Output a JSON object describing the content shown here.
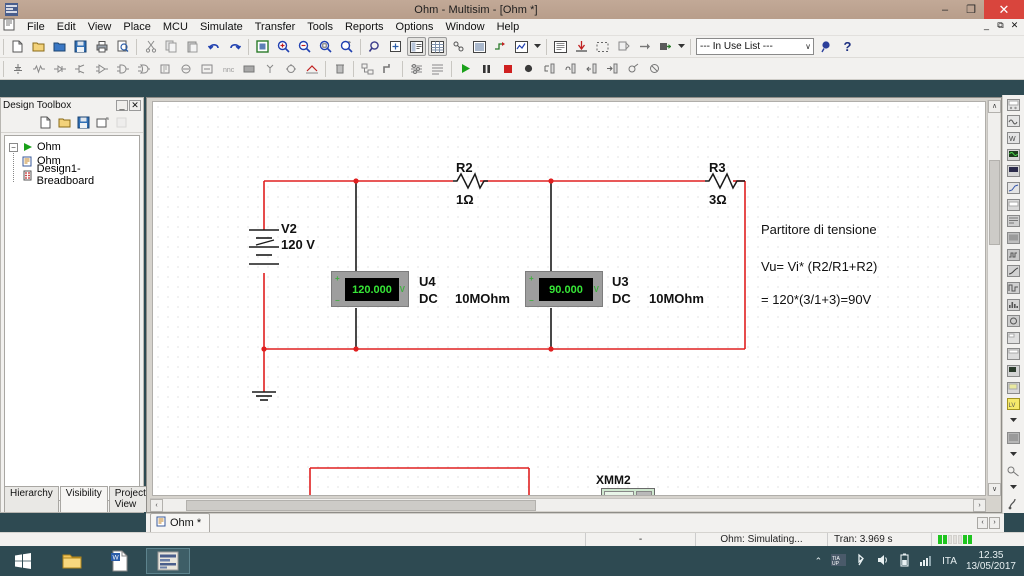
{
  "window": {
    "title": "Ohm - Multisim - [Ohm *]",
    "app_icon": "multisim-icon",
    "minimize_label": "–",
    "maximize_label": "❐",
    "close_label": "✕",
    "mdi_minimize": "_",
    "mdi_restore": "⧉",
    "mdi_close": "✕"
  },
  "menubar": {
    "items": [
      {
        "label": "File"
      },
      {
        "label": "Edit"
      },
      {
        "label": "View"
      },
      {
        "label": "Place"
      },
      {
        "label": "MCU"
      },
      {
        "label": "Simulate"
      },
      {
        "label": "Transfer"
      },
      {
        "label": "Tools"
      },
      {
        "label": "Reports"
      },
      {
        "label": "Options"
      },
      {
        "label": "Window"
      },
      {
        "label": "Help"
      }
    ]
  },
  "toolbar_main": {
    "groups": [
      [
        "new-file-icon",
        "open-file-icon",
        "open-sample-icon",
        "save-icon",
        "print-icon",
        "print-preview-icon"
      ],
      [
        "cut-icon",
        "copy-icon",
        "paste-icon",
        "undo-icon",
        "redo-icon"
      ],
      [
        "full-screen-icon",
        "zoom-in-icon",
        "zoom-out-icon",
        "zoom-area-icon",
        "zoom-fit-icon"
      ],
      [
        "zoom-selection-icon",
        "toggle-parent-sheet-icon",
        "design-toolbox-icon",
        "spreadsheet-view-icon",
        "sp ice-netlist-icon",
        "grapher-icon",
        "postprocessor-icon",
        "analysis-icon"
      ],
      [
        "electrical-rules-check-icon",
        "capture-screen-area-icon",
        "back-annotate-icon",
        "forward-annotate-icon",
        "in-use-list-icon"
      ]
    ],
    "in_use_list": {
      "value": "--- In Use List ---",
      "arrow": "∨"
    },
    "help_button": "?",
    "search_help_icon": "help-search-icon"
  },
  "toolbar_components": {
    "buttons": [
      "source-icon",
      "basic-icon",
      "diode-icon",
      "transistor-icon",
      "analog-icon",
      "ttl-icon",
      "cmos-icon",
      "misc-digital-icon",
      "mixed-icon",
      "indicator-icon",
      "power-icon",
      "misc-icon",
      "advanced-peripherals-icon",
      "rf-icon",
      "electromechanical-icon",
      "ni-components-icon",
      "place-hierarchical-block-icon",
      "bus-icon",
      "edit-icon"
    ],
    "sim_buttons": [
      "run-icon",
      "pause-icon",
      "stop-icon",
      "record-icon",
      "step-into-icon",
      "step-over-icon",
      "step-out-icon",
      "run-to-cursor-icon",
      "toggle-breakpoint-icon",
      "remove-breakpoints-icon"
    ]
  },
  "design_toolbox": {
    "title": "Design Toolbox",
    "collapse_label": "_",
    "close_label": "✕",
    "toolbar_icons": [
      "new-design-icon",
      "open-design-icon",
      "save-design-icon",
      "new-sheet-icon",
      "delete-sheet-icon"
    ],
    "tree": {
      "root": {
        "label": "Ohm",
        "expander": "−",
        "icon": "design-root-icon"
      },
      "children": [
        {
          "label": "Ohm",
          "icon": "schematic-sheet-icon"
        },
        {
          "label": "Design1-Breadboard",
          "icon": "breadboard-icon"
        }
      ]
    },
    "tabs": [
      {
        "label": "Hierarchy",
        "active": false
      },
      {
        "label": "Visibility",
        "active": true
      },
      {
        "label": "Project View",
        "active": false
      }
    ]
  },
  "workspace": {
    "scroll_up": "∧",
    "scroll_down": "∨",
    "scroll_left": "‹",
    "scroll_right": "›",
    "circuit": {
      "components": [
        {
          "ref": "V2",
          "value": "120 V",
          "type": "dc-voltage-source"
        },
        {
          "ref": "R2",
          "value": "1Ω",
          "type": "resistor"
        },
        {
          "ref": "R3",
          "value": "3Ω",
          "type": "resistor"
        },
        {
          "ref": "U4",
          "type": "multimeter",
          "mode": "DC",
          "impedance": "10MOhm",
          "reading": "120.000",
          "terminal_plus": "+",
          "terminal_minus": "−",
          "terminal_unit": "V"
        },
        {
          "ref": "U3",
          "type": "multimeter",
          "mode": "DC",
          "impedance": "10MOhm",
          "reading": "90.000",
          "terminal_plus": "+",
          "terminal_minus": "−",
          "terminal_unit": "V"
        },
        {
          "ref": "XMM2",
          "type": "multimeter-instrument"
        }
      ],
      "annotation": {
        "line1": "Partitore di tensione",
        "line2": "Vu= Vi* (R2/R1+R2)",
        "line3": "= 120*(3/1+3)=90V"
      },
      "colors": {
        "wire": "#e02020",
        "component": "#111111",
        "lcd_text": "#37e637",
        "lcd_bg": "#000000",
        "meter_body": "#9e9e9e"
      }
    }
  },
  "doc_tabs": {
    "tabs": [
      {
        "label": "Ohm *",
        "icon": "schematic-tab-icon",
        "active": true
      }
    ],
    "nav": [
      "‹",
      "›"
    ]
  },
  "statusbar": {
    "left": "",
    "middle": "-",
    "project": "Ohm: Simulating...",
    "transient": "Tran: 3.969 s",
    "activity_bars": [
      true,
      true,
      false,
      false,
      false,
      true,
      true
    ]
  },
  "taskbar": {
    "start_icon": "windows-start-icon",
    "items": [
      {
        "icon": "file-explorer-icon",
        "active": false
      },
      {
        "icon": "word-document-icon",
        "active": false
      },
      {
        "icon": "multisim-app-icon",
        "active": true
      }
    ],
    "tray": {
      "show_hidden": "⌃",
      "icons": [
        "tia-portal-icon",
        "bluetooth-icon",
        "volume-icon",
        "battery-icon",
        "network-icon"
      ],
      "language": "ITA",
      "time": "12.35",
      "date": "13/05/2017"
    }
  }
}
